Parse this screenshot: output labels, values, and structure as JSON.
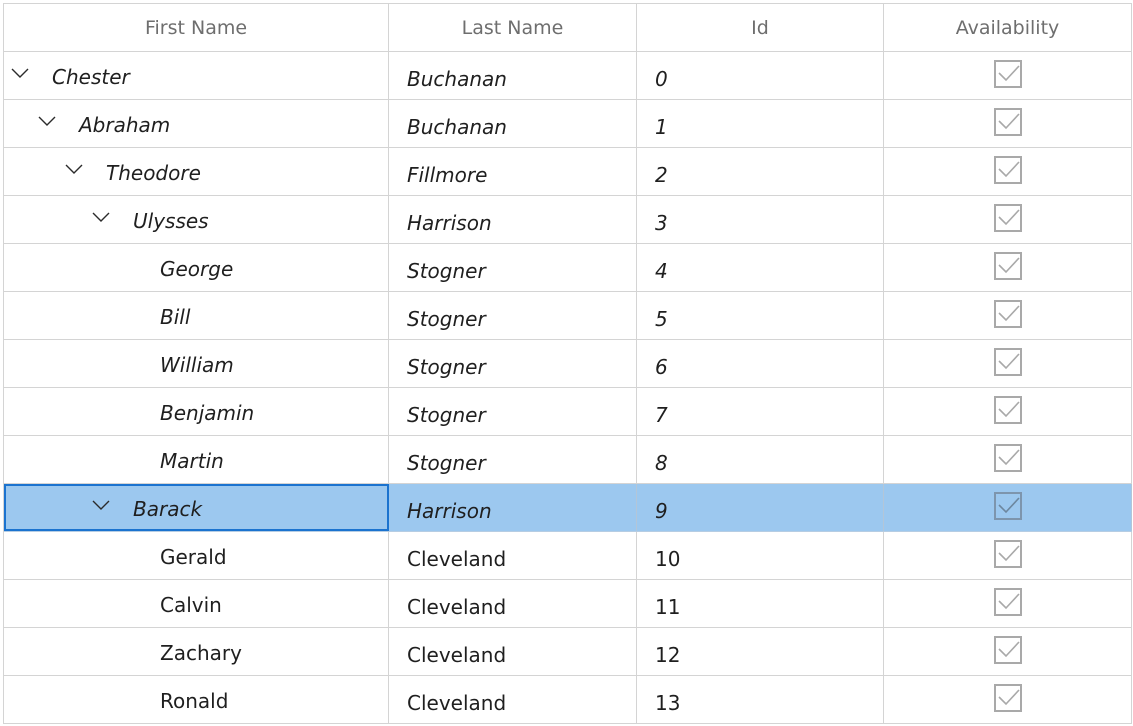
{
  "columns": {
    "first_name": "First Name",
    "last_name": "Last Name",
    "id": "Id",
    "availability": "Availability"
  },
  "rows": [
    {
      "first": "Chester",
      "last": "Buchanan",
      "id": "0",
      "level": 0,
      "expander": "chevron-down-icon",
      "italic": true,
      "available": true
    },
    {
      "first": "Abraham",
      "last": "Buchanan",
      "id": "1",
      "level": 1,
      "expander": "chevron-down-icon",
      "italic": true,
      "available": true
    },
    {
      "first": "Theodore",
      "last": "Fillmore",
      "id": "2",
      "level": 2,
      "expander": "chevron-down-icon",
      "italic": true,
      "available": true
    },
    {
      "first": "Ulysses",
      "last": "Harrison",
      "id": "3",
      "level": 3,
      "expander": "chevron-down-icon",
      "italic": true,
      "available": true
    },
    {
      "first": "George",
      "last": "Stogner",
      "id": "4",
      "level": 4,
      "expander": "",
      "italic": true,
      "available": true
    },
    {
      "first": "Bill",
      "last": "Stogner",
      "id": "5",
      "level": 4,
      "expander": "",
      "italic": true,
      "available": true
    },
    {
      "first": "William",
      "last": "Stogner",
      "id": "6",
      "level": 4,
      "expander": "",
      "italic": true,
      "available": true
    },
    {
      "first": "Benjamin",
      "last": "Stogner",
      "id": "7",
      "level": 4,
      "expander": "",
      "italic": true,
      "available": true
    },
    {
      "first": "Martin",
      "last": "Stogner",
      "id": "8",
      "level": 4,
      "expander": "",
      "italic": true,
      "available": true
    },
    {
      "first": "Barack",
      "last": "Harrison",
      "id": "9",
      "level": 3,
      "expander": "chevron-down-icon",
      "italic": true,
      "available": true,
      "selected": true
    },
    {
      "first": "Gerald",
      "last": "Cleveland",
      "id": "10",
      "level": 4,
      "expander": "",
      "italic": false,
      "available": true
    },
    {
      "first": "Calvin",
      "last": "Cleveland",
      "id": "11",
      "level": 4,
      "expander": "",
      "italic": false,
      "available": true
    },
    {
      "first": "Zachary",
      "last": "Cleveland",
      "id": "12",
      "level": 4,
      "expander": "",
      "italic": false,
      "available": true
    },
    {
      "first": "Ronald",
      "last": "Cleveland",
      "id": "13",
      "level": 4,
      "expander": "",
      "italic": false,
      "available": true
    }
  ],
  "colors": {
    "grid_line": "#d4d4d4",
    "header_text": "#6e6e6e",
    "selected_row": "#9cc8ef",
    "focus_border": "#1b73cf",
    "checkbox": "#a9a9a9"
  }
}
